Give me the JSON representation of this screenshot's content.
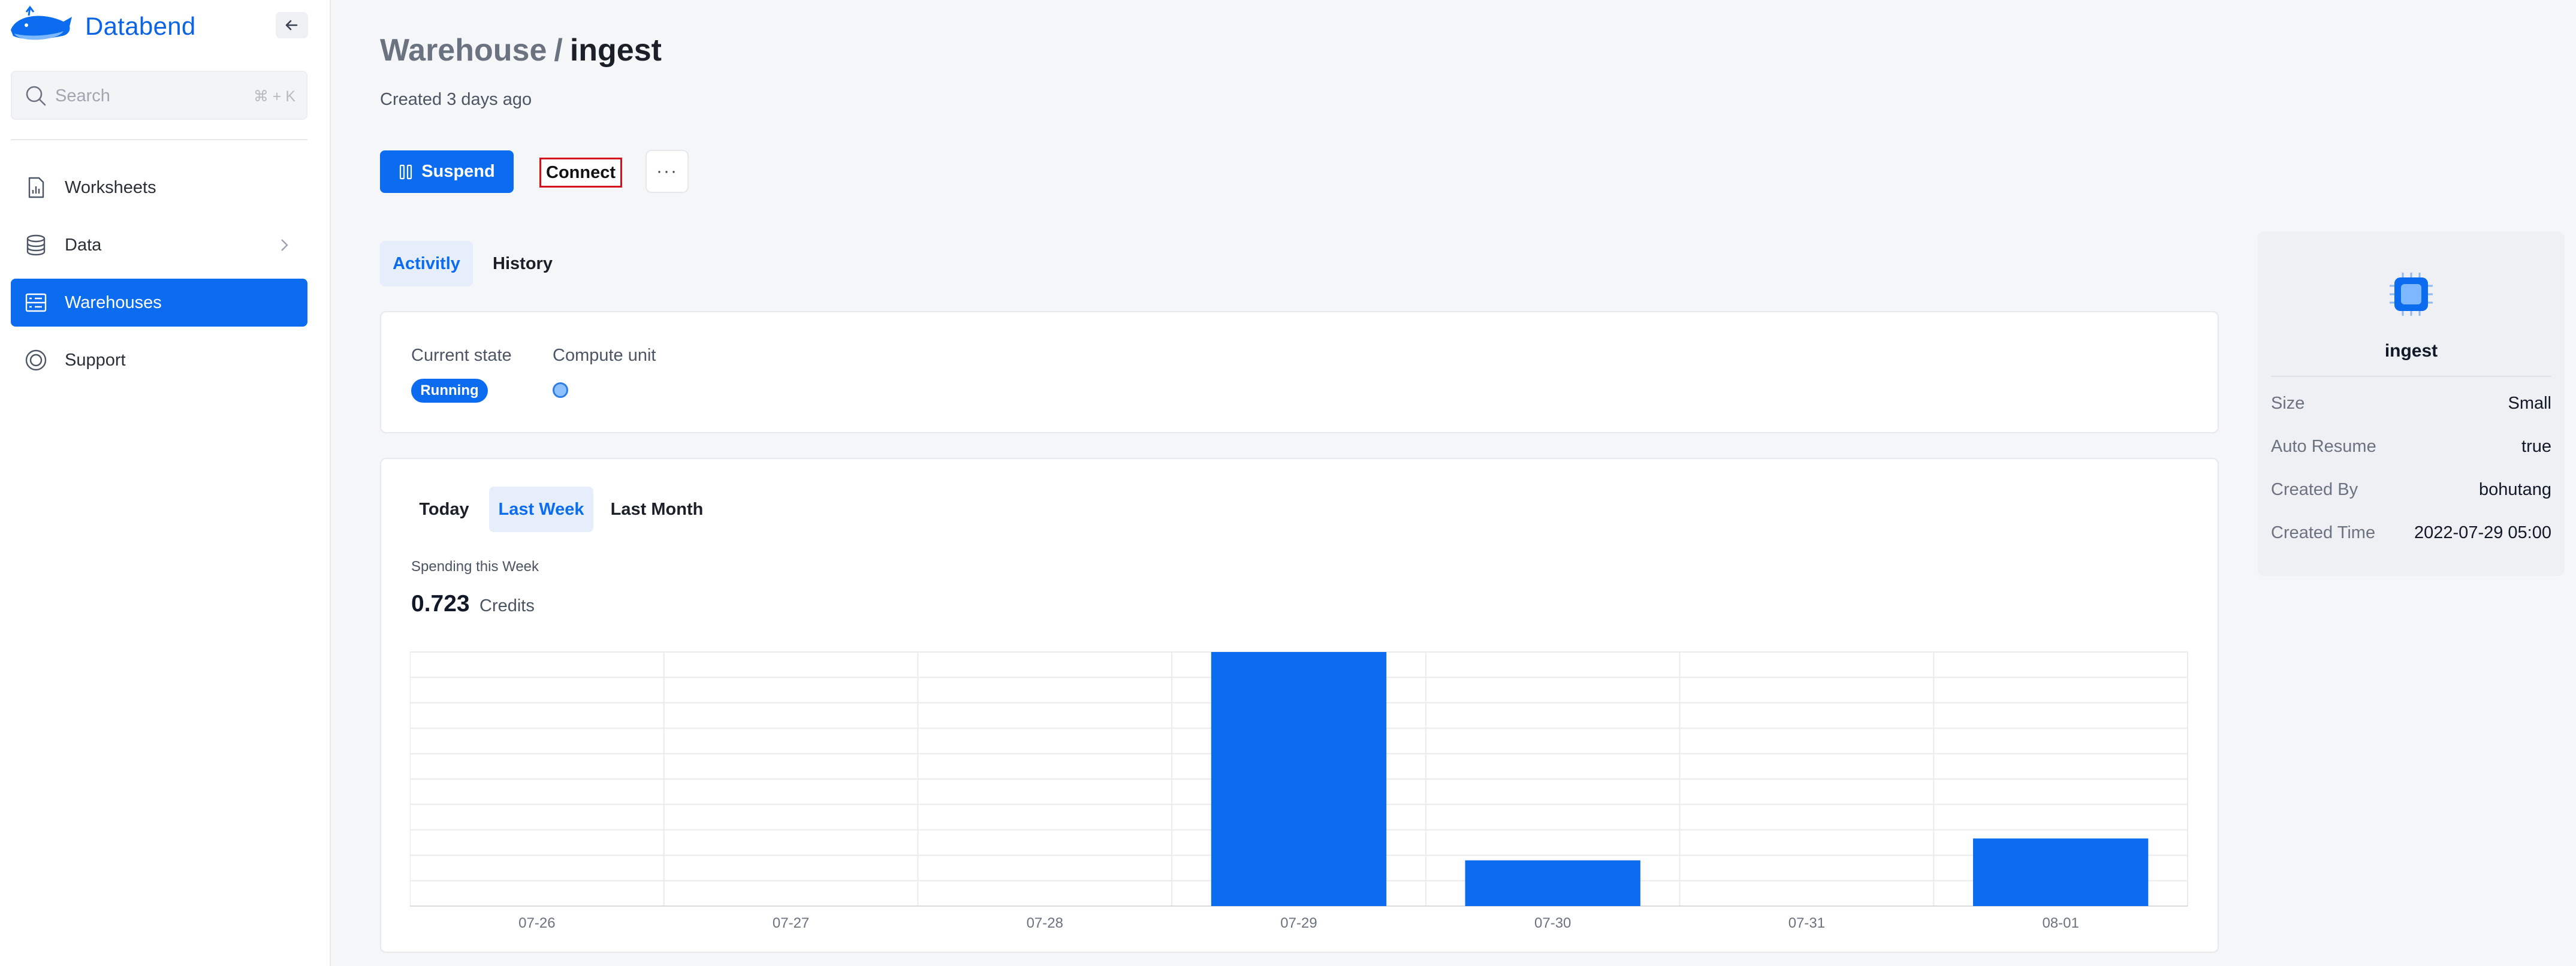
{
  "app": {
    "brand": "Databend"
  },
  "sidebar": {
    "search_placeholder": "Search",
    "search_shortcut": "⌘ + K",
    "items": [
      {
        "label": "Worksheets",
        "icon": "worksheet-icon"
      },
      {
        "label": "Data",
        "icon": "database-icon"
      },
      {
        "label": "Warehouses",
        "icon": "warehouse-icon",
        "active": true
      },
      {
        "label": "Support",
        "icon": "support-icon"
      }
    ]
  },
  "header": {
    "breadcrumb_parent": "Warehouse",
    "separator": "/",
    "title": "ingest",
    "created": "Created 3 days ago"
  },
  "actions": {
    "suspend": "Suspend",
    "connect": "Connect",
    "more": "···"
  },
  "tabs": [
    {
      "label": "Activitly",
      "active": true
    },
    {
      "label": "History",
      "active": false
    }
  ],
  "state": {
    "current_state_label": "Current state",
    "current_state_value": "Running",
    "compute_unit_label": "Compute unit"
  },
  "usage": {
    "ranges": [
      {
        "label": "Today",
        "active": false
      },
      {
        "label": "Last Week",
        "active": true
      },
      {
        "label": "Last Month",
        "active": false
      }
    ],
    "spending_label": "Spending this Week",
    "spending_value": "0.723",
    "spending_unit": "Credits"
  },
  "chart_data": {
    "type": "bar",
    "categories": [
      "07-26",
      "07-27",
      "07-28",
      "07-29",
      "07-30",
      "07-31",
      "08-01"
    ],
    "values": [
      0,
      0,
      0,
      0.5,
      0.09,
      0,
      0.133
    ],
    "ylim": [
      0,
      0.5
    ],
    "grid": true,
    "bar_color": "#0b6cef"
  },
  "details": {
    "name": "ingest",
    "rows": [
      {
        "key": "Size",
        "value": "Small"
      },
      {
        "key": "Auto Resume",
        "value": "true"
      },
      {
        "key": "Created By",
        "value": "bohutang"
      },
      {
        "key": "Created Time",
        "value": "2022-07-29 05:00"
      }
    ]
  },
  "colors": {
    "accent": "#0b6cef",
    "highlight_border": "#d6101b"
  }
}
